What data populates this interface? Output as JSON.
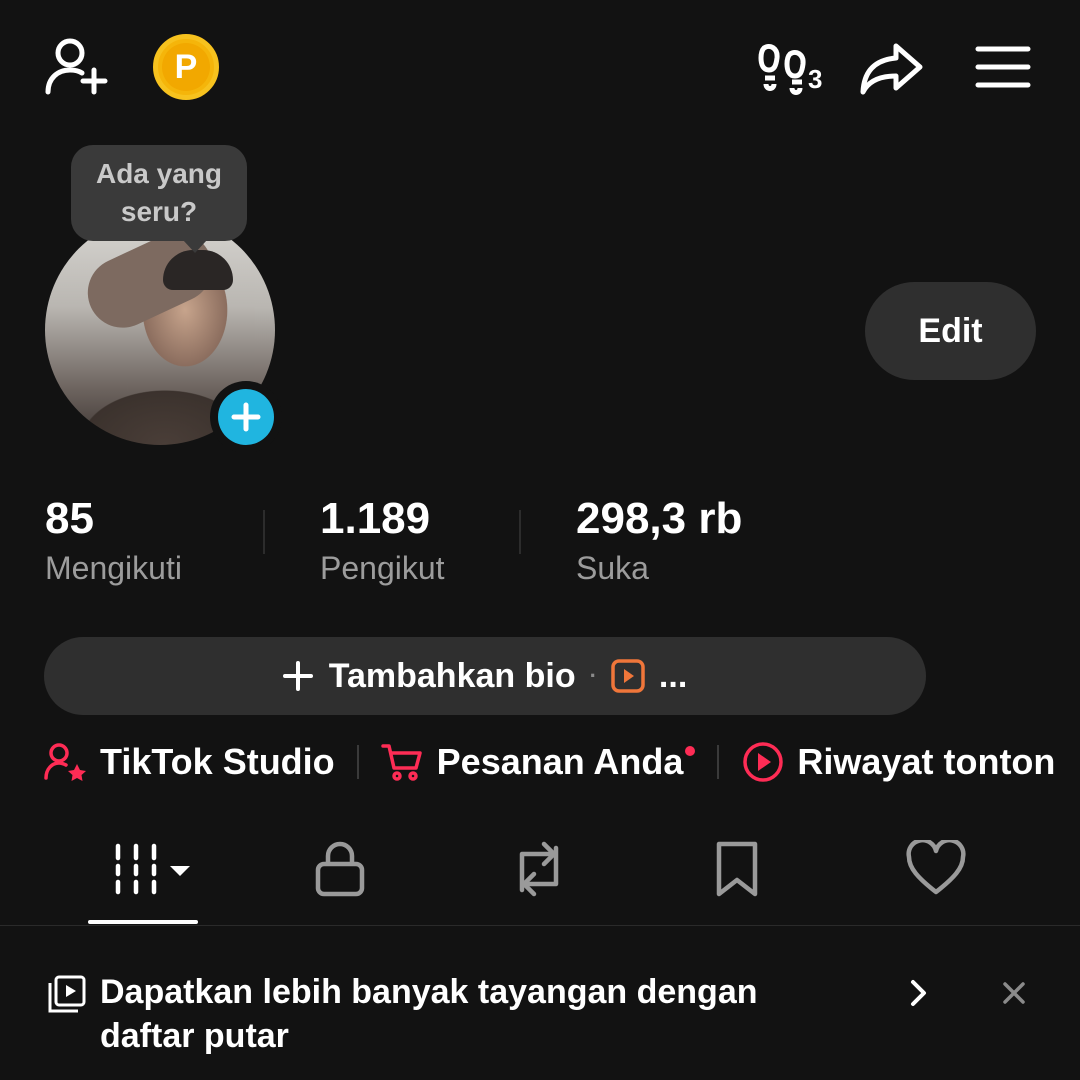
{
  "topbar": {
    "add_friend_icon": "add-user-icon",
    "coin_letter": "P",
    "visitors_count": "3",
    "share_icon": "share-icon",
    "menu_icon": "hamburger-menu-icon"
  },
  "profile": {
    "bubble_text": "Ada yang seru?",
    "edit_label": "Edit"
  },
  "stats": [
    {
      "value": "85",
      "label": "Mengikuti"
    },
    {
      "value": "1.189",
      "label": "Pengikut"
    },
    {
      "value": "298,3 rb",
      "label": "Suka"
    }
  ],
  "bio": {
    "add_label": "Tambahkan bio",
    "separator": "·",
    "more": "..."
  },
  "shortcuts": [
    {
      "label": "TikTok Studio",
      "icon": "creator-star-icon"
    },
    {
      "label": "Pesanan Anda",
      "icon": "cart-icon"
    },
    {
      "label": "Riwayat tonton",
      "icon": "play-circle-icon"
    }
  ],
  "tabs": [
    "videos-grid-icon",
    "lock-icon",
    "repost-icon",
    "bookmark-icon",
    "heart-icon"
  ],
  "banner": {
    "text": "Dapatkan lebih banyak tayangan dengan daftar putar"
  },
  "colors": {
    "background": "#121212",
    "accent_red": "#fe2c55",
    "accent_blue": "#20b5e0",
    "coin": "#f5b50a"
  }
}
